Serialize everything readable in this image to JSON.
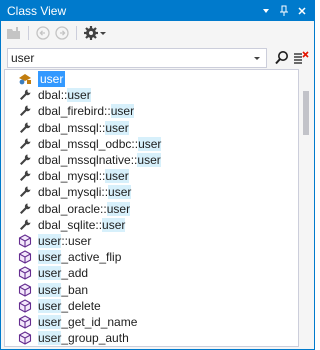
{
  "window": {
    "title": "Class View",
    "accent": "#007acc"
  },
  "toolbar": {
    "buttons": [
      "new-folder-icon",
      "back-arrow-icon",
      "forward-arrow-icon",
      "settings-gear-icon",
      "chevron-down-icon"
    ]
  },
  "search": {
    "value": "user",
    "placeholder": ""
  },
  "search_buttons": [
    "search-icon",
    "clear-search-icon"
  ],
  "tree": {
    "highlight_color": "#d7f0fb",
    "selected_color": "#3399ff",
    "items": [
      {
        "type": "namespace",
        "label": "user",
        "match": "user",
        "rest": "",
        "selected": true
      },
      {
        "type": "function",
        "match": "",
        "before": "dbal::",
        "label": "user"
      },
      {
        "type": "function",
        "match": "",
        "before": "dbal_firebird::",
        "label": "user"
      },
      {
        "type": "function",
        "match": "",
        "before": "dbal_mssql::",
        "label": "user"
      },
      {
        "type": "function",
        "match": "",
        "before": "dbal_mssql_odbc::",
        "label": "user"
      },
      {
        "type": "function",
        "match": "",
        "before": "dbal_mssqlnative::",
        "label": "user"
      },
      {
        "type": "function",
        "match": "",
        "before": "dbal_mysql::",
        "label": "user"
      },
      {
        "type": "function",
        "match": "",
        "before": "dbal_mysqli::",
        "label": "user"
      },
      {
        "type": "function",
        "match": "",
        "before": "dbal_oracle::",
        "label": "user"
      },
      {
        "type": "function",
        "match": "",
        "before": "dbal_sqlite::",
        "label": "user"
      },
      {
        "type": "class",
        "label": "user",
        "rest": "::user"
      },
      {
        "type": "class",
        "label": "user",
        "rest": "_active_flip"
      },
      {
        "type": "class",
        "label": "user",
        "rest": "_add"
      },
      {
        "type": "class",
        "label": "user",
        "rest": "_ban"
      },
      {
        "type": "class",
        "label": "user",
        "rest": "_delete"
      },
      {
        "type": "class",
        "label": "user",
        "rest": "_get_id_name"
      },
      {
        "type": "class",
        "label": "user",
        "rest": "_group_auth"
      }
    ]
  }
}
